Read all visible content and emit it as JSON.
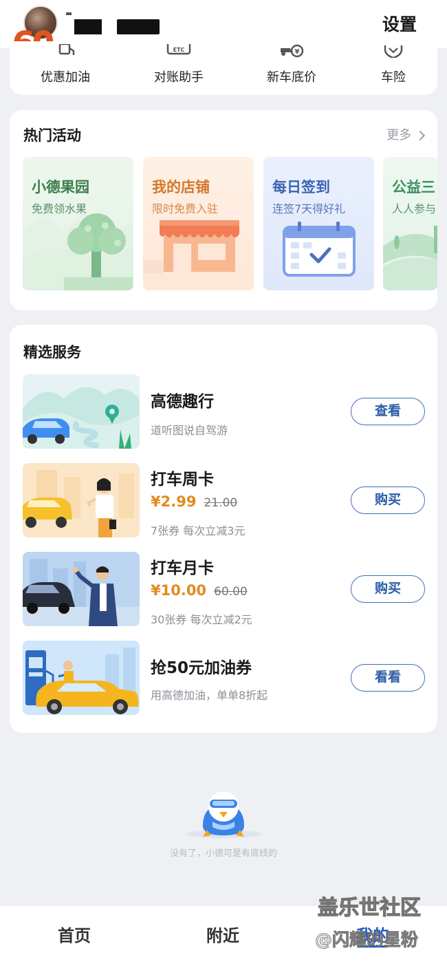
{
  "header": {
    "settings_label": "设置",
    "level_badge": "60"
  },
  "quick_links": [
    {
      "label": "优惠加油",
      "icon": "fuel-pump-icon"
    },
    {
      "label": "对账助手",
      "icon": "etc-card-icon"
    },
    {
      "label": "新车底价",
      "icon": "car-price-icon"
    },
    {
      "label": "车险",
      "icon": "shield-icon"
    }
  ],
  "activities": {
    "title": "热门活动",
    "more_label": "更多",
    "items": [
      {
        "title": "小德果园",
        "subtitle": "免费领水果"
      },
      {
        "title": "我的店铺",
        "subtitle": "限时免费入驻"
      },
      {
        "title": "每日签到",
        "subtitle": "连签7天得好礼"
      },
      {
        "title": "公益三",
        "subtitle": "人人参与"
      }
    ]
  },
  "services": {
    "title": "精选服务",
    "items": [
      {
        "title": "高德趣行",
        "price_now": "",
        "price_old": "",
        "desc": "道听图说自驾游",
        "button": "查看"
      },
      {
        "title": "打车周卡",
        "price_now": "¥2.99",
        "price_old": "21.00",
        "desc": "7张券 每次立减3元",
        "button": "购买"
      },
      {
        "title": "打车月卡",
        "price_now": "¥10.00",
        "price_old": "60.00",
        "desc": "30张券 每次立减2元",
        "button": "购买"
      },
      {
        "title": "抢50元加油券",
        "price_now": "",
        "price_old": "",
        "desc": "用高德加油，单单8折起",
        "button": "看看"
      }
    ]
  },
  "footer_note": "没有了，小德可是有底线的",
  "tabbar": {
    "home": "首页",
    "nearby": "附近",
    "mine": "我的"
  },
  "watermark": {
    "line1": "盖乐世社区",
    "line2": "@闪耀的星粉"
  },
  "colors": {
    "accent_blue": "#1c5fd1",
    "price_orange": "#e38a1f",
    "page_bg": "#eef0f4"
  }
}
